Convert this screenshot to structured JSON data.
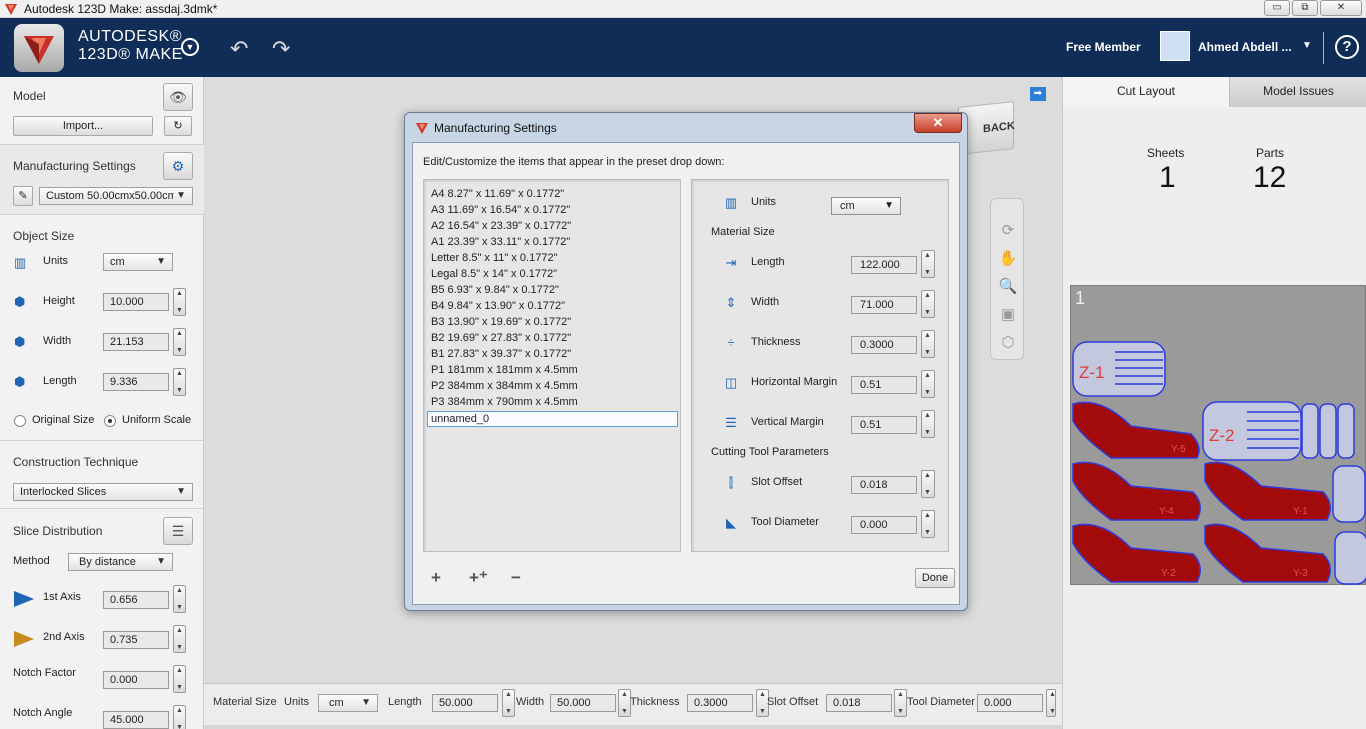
{
  "window": {
    "title": "Autodesk 123D Make: assdaj.3dmk*",
    "minimize": "▭",
    "maximize": "⧉",
    "close": "✕"
  },
  "header": {
    "brand_line1": "AUTODESK®",
    "brand_line2": "123D® MAKE",
    "member_label": "Free Member",
    "user_name": "Ahmed Abdell ...",
    "colors": {
      "bar": "#0f2d57",
      "accent": "#2d7fd6"
    }
  },
  "left": {
    "model": {
      "title": "Model",
      "import_label": "Import..."
    },
    "manufacturing": {
      "title": "Manufacturing Settings",
      "preset": "Custom 50.00cmx50.00cm"
    },
    "object_size": {
      "title": "Object Size",
      "units_label": "Units",
      "units_value": "cm",
      "height_label": "Height",
      "height_value": "10.000",
      "width_label": "Width",
      "width_value": "21.153",
      "length_label": "Length",
      "length_value": "9.336",
      "original_size": "Original Size",
      "uniform_scale": "Uniform Scale"
    },
    "construction": {
      "title": "Construction Technique",
      "value": "Interlocked Slices"
    },
    "slice": {
      "title": "Slice Distribution",
      "method_label": "Method",
      "method_value": "By distance",
      "axis1_label": "1st Axis",
      "axis1_value": "0.656",
      "axis2_label": "2nd Axis",
      "axis2_value": "0.735",
      "notch_factor_label": "Notch Factor",
      "notch_factor_value": "0.000",
      "notch_angle_label": "Notch Angle",
      "notch_angle_value": "45.000"
    }
  },
  "canvas": {
    "back_label": "BACK"
  },
  "bottom": {
    "material_size": "Material Size",
    "units_label": "Units",
    "units_value": "cm",
    "length_label": "Length",
    "length_value": "50.000",
    "width_label": "Width",
    "width_value": "50.000",
    "thickness_label": "Thickness",
    "thickness_value": "0.3000",
    "slot_offset_label": "Slot Offset",
    "slot_offset_value": "0.018",
    "tool_diameter_label": "Tool Diameter",
    "tool_diameter_value": "0.000"
  },
  "right": {
    "tab_cut_layout": "Cut Layout",
    "tab_model_issues": "Model Issues",
    "sheets_label": "Sheets",
    "sheets_value": "1",
    "parts_label": "Parts",
    "parts_value": "12",
    "sheet_number": "1",
    "part_labels": [
      "Z-1",
      "Z-2",
      "Y-5",
      "Y-4",
      "Y-1",
      "Y-2",
      "Y-3"
    ]
  },
  "dialog": {
    "title": "Manufacturing Settings",
    "hint": "Edit/Customize the items that appear in the preset drop down:",
    "presets": [
      "A4 8.27\" x 11.69\" x 0.1772\"",
      "A3 11.69\" x 16.54\" x 0.1772\"",
      "A2 16.54\" x 23.39\" x 0.1772\"",
      "A1 23.39\" x 33.11\" x 0.1772\"",
      "Letter 8.5\" x 11\" x 0.1772\"",
      "Legal 8.5\" x 14\" x 0.1772\"",
      "B5 6.93\" x 9.84\" x 0.1772\"",
      "B4 9.84\" x 13.90\" x 0.1772\"",
      "B3 13.90\" x 19.69\" x 0.1772\"",
      "B2 19.69\" x 27.83\" x 0.1772\"",
      "B1 27.83\" x 39.37\" x 0.1772\"",
      "P1 181mm x 181mm x 4.5mm",
      "P2 384mm x 384mm x 4.5mm",
      "P3 384mm x 790mm x 4.5mm"
    ],
    "editing_preset": "unnamed_0",
    "units_label": "Units",
    "units_value": "cm",
    "material_size_heading": "Material Size",
    "length_label": "Length",
    "length_value": "122.000",
    "width_label": "Width",
    "width_value": "71.000",
    "thickness_label": "Thickness",
    "thickness_value": "0.3000",
    "hmargin_label": "Horizontal Margin",
    "hmargin_value": "0.51",
    "vmargin_label": "Vertical Margin",
    "vmargin_value": "0.51",
    "cutting_heading": "Cutting Tool Parameters",
    "slot_offset_label": "Slot Offset",
    "slot_offset_value": "0.018",
    "tool_diameter_label": "Tool Diameter",
    "tool_diameter_value": "0.000",
    "add_label": "+",
    "duplicate_label": "+⁺",
    "remove_label": "−",
    "done_label": "Done"
  }
}
